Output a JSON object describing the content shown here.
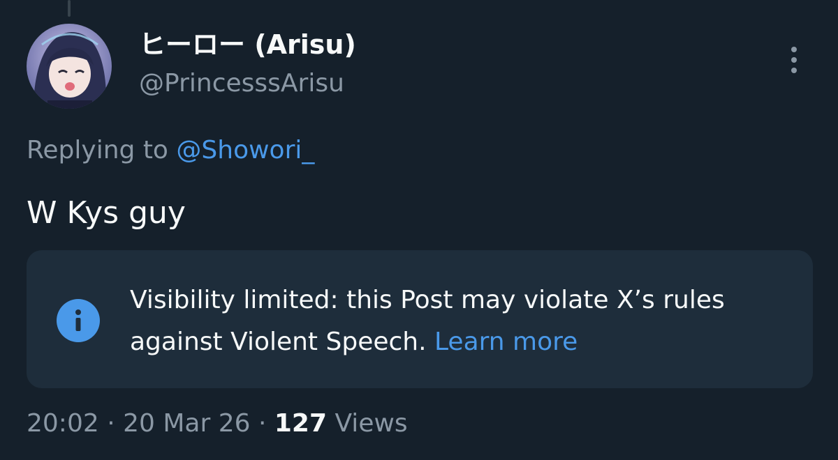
{
  "author": {
    "display_name": "ヒーロー (Arisu)",
    "handle": "@PrincesssArisu",
    "avatar_icon": "avatar-image"
  },
  "more_icon": "more-vertical-icon",
  "reply": {
    "prefix": "Replying to ",
    "mention": "@Showori_"
  },
  "post": {
    "text": "W Kys guy"
  },
  "notice": {
    "icon": "info-icon",
    "text": "Visibility limited: this Post may violate X’s rules against Violent Speech. ",
    "link_label": "Learn more"
  },
  "meta": {
    "time": "20:02",
    "separator": " · ",
    "date": "20 Mar 26",
    "views_count": "127",
    "views_label": " Views"
  },
  "colors": {
    "background": "#15202b",
    "link": "#4a99e9",
    "secondary_text": "#8b98a5",
    "notice_background": "#1e2d3b"
  }
}
